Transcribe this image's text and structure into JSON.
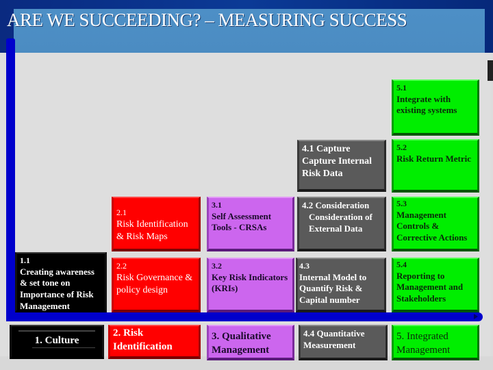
{
  "title": "ARE WE SUCCEEDING? – MEASURING SUCCESS",
  "colors": {
    "axis": "#0000cc",
    "culture": "#000000",
    "risk_identification": "#ff0000",
    "qualitative": "#cc66ee",
    "quantitative": "#5a5a5a",
    "integrated": "#00ee00",
    "title_panel": "#4d8fc6"
  },
  "columns": [
    {
      "stage": "1. Culture",
      "steps": [
        {
          "num": "1.1",
          "text": "Creating awareness & set tone on Importance of Risk Management"
        }
      ]
    },
    {
      "stage": "2. Risk Identification",
      "steps": [
        {
          "num": "2.1",
          "text": "Risk Identification & Risk Maps"
        },
        {
          "num": "2.2",
          "text": "Risk Governance & policy design"
        }
      ]
    },
    {
      "stage": "3. Qualitative Management",
      "steps": [
        {
          "num": "3.1",
          "text": "Self Assessment Tools - CRSAs"
        },
        {
          "num": "3.2",
          "text": "Key Risk Indicators (KRIs)"
        }
      ]
    },
    {
      "stage": "4.4 Quantitative Measurement",
      "steps": [
        {
          "num": "4.1 Capture",
          "text": "Capture Internal Risk Data"
        },
        {
          "num": "4.2 Consideration",
          "text": "Consideration of External Data"
        },
        {
          "num": "4.3",
          "text": "Internal Model to Quantify Risk & Capital number"
        }
      ]
    },
    {
      "stage": "5. Integrated Management",
      "steps": [
        {
          "num": "5.1",
          "text": "Integrate with existing systems"
        },
        {
          "num": "5.2",
          "text": "Risk Return Metric"
        },
        {
          "num": "5.3",
          "text": "Management Controls & Corrective Actions"
        },
        {
          "num": "5.4",
          "text": "Reporting to Management and Stakeholders"
        }
      ]
    }
  ]
}
